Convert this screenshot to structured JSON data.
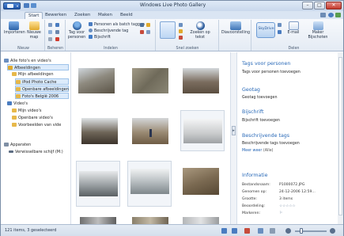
{
  "window": {
    "title": "Windows Live Photo Gallery",
    "minimize": "–",
    "maximize": "□",
    "close": "✕"
  },
  "tabs": [
    {
      "label": "Start"
    },
    {
      "label": "Bewerken"
    },
    {
      "label": "Zoeken"
    },
    {
      "label": "Maken"
    },
    {
      "label": "Beeld"
    }
  ],
  "ribbon": {
    "groups": {
      "nieuw": "Nieuw",
      "beheren": "Beheren",
      "indelen": "Indelen",
      "snel_zoeken": "Snel zoeken",
      "delen": "Delen"
    },
    "importeren": "Importeren",
    "nieuwe_map": "Nieuwe map",
    "tag_voor_personen": "Tag voor personen",
    "personen_batch": "Personen als batch taggen",
    "beschrijvende_tag": "Beschrijvende tag",
    "bijschrift": "Bijschrift",
    "zoeken_op_tekst": "Zoeken op tekst",
    "diavoorstelling": "Diavoorstelling",
    "skydrive": "SkyDrive",
    "email": "E-mail",
    "maker": "Maker Bijschoten"
  },
  "nav": {
    "items": [
      {
        "label": "Alle foto's en video's"
      },
      {
        "label": "Afbeeldingen"
      },
      {
        "label": "Mijn afbeeldingen"
      },
      {
        "label": "iPod Photo Cache"
      },
      {
        "label": "Openbare afbeeldingen"
      },
      {
        "label": "Foto's België 2006"
      },
      {
        "label": "Video's"
      },
      {
        "label": "Mijn video's"
      },
      {
        "label": "Openbare video's"
      },
      {
        "label": "Voorbeelden van vide"
      },
      {
        "label": "Apparaten"
      },
      {
        "label": "Verwisselbare schijf (M:)"
      }
    ]
  },
  "info": {
    "tags_personen": "Tags voor personen",
    "tags_personen_add": "Tags voor personen toevoegen",
    "geotag": "Geotag",
    "geotag_add": "Geotag toevoegen",
    "bijschrift": "Bijschrift",
    "bijschrift_add": "Bijschrift toevoegen",
    "beschrijvende_tags": "Beschrijvende tags",
    "beschrijvende_tags_add": "Beschrijvende tags toevoegen",
    "meer_weer": "Meer weer",
    "alle": "(Alle)",
    "informatie": "Informatie",
    "rows": [
      {
        "key": "Bestandsnaam:",
        "value": "P1000072.JPG"
      },
      {
        "key": "Genomen op:",
        "value": "24-12-2006 12:59..."
      },
      {
        "key": "Grootte:",
        "value": "3 items"
      },
      {
        "key": "Beoordeling:",
        "value": "☆☆☆☆☆"
      },
      {
        "key": "Markeren:",
        "value": "⚐"
      }
    ]
  },
  "status": {
    "text": "121 items, 3 geselecteerd"
  }
}
